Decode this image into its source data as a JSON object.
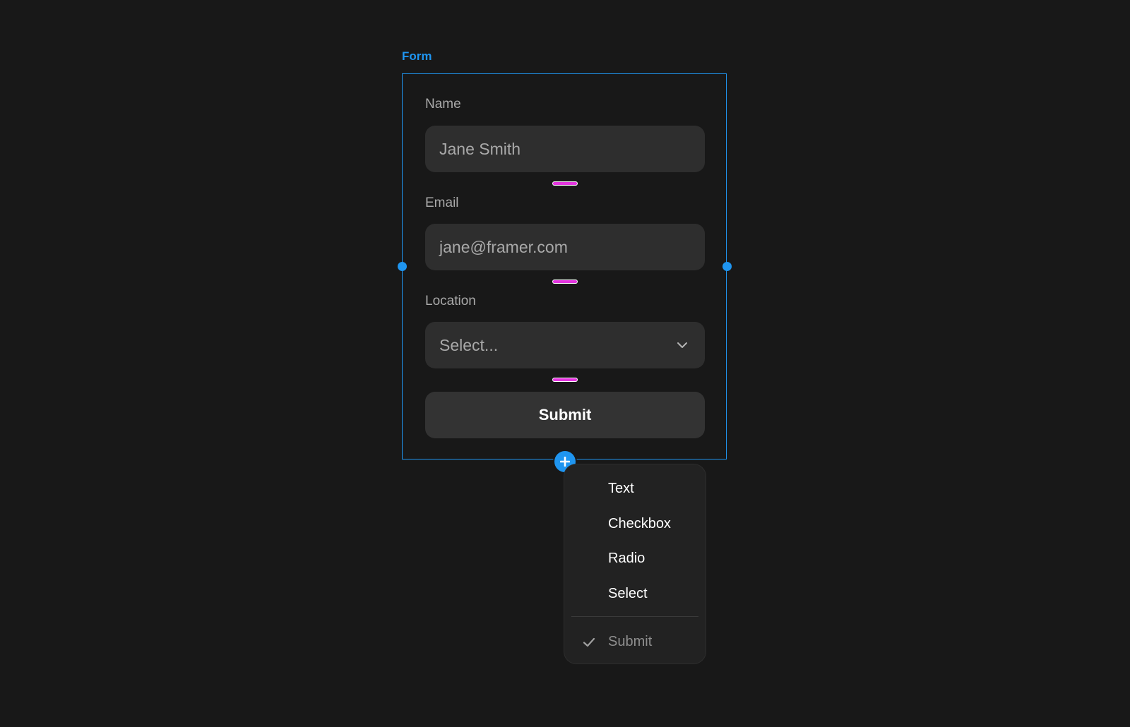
{
  "frame": {
    "label": "Form",
    "accent_color": "#1f95f0",
    "gap_marker_color": "#e535e0"
  },
  "form": {
    "name": {
      "label": "Name",
      "placeholder": "Jane Smith"
    },
    "email": {
      "label": "Email",
      "placeholder": "jane@framer.com"
    },
    "location": {
      "label": "Location",
      "placeholder": "Select...",
      "icon": "chevron-down-icon"
    },
    "submit_label": "Submit"
  },
  "add_menu": {
    "trigger_icon": "plus-icon",
    "items": [
      {
        "label": "Text"
      },
      {
        "label": "Checkbox"
      },
      {
        "label": "Radio"
      },
      {
        "label": "Select"
      }
    ],
    "checked_item": {
      "label": "Submit",
      "icon": "check-icon",
      "checked": true
    }
  }
}
